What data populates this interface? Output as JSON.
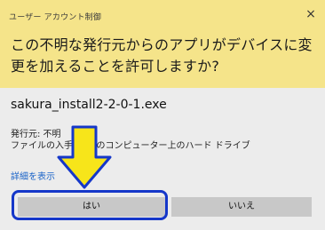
{
  "dialog": {
    "title": "ユーザー アカウント制御",
    "close_glyph": "×",
    "question": "この不明な発行元からのアプリがデバイスに変更を加えることを許可しますか?",
    "filename": "sakura_install2-2-0-1.exe",
    "publisher": "発行元: 不明",
    "origin": "ファイルの入手先: このコンピューター上のハード ドライブ",
    "details_link": "詳細を表示",
    "yes_label": "はい",
    "no_label": "いいえ"
  },
  "colors": {
    "header_bg": "#f5e48a",
    "focus_ring": "#1537c9",
    "arrow_fill": "#f7e51a",
    "arrow_stroke": "#1537c9"
  },
  "icons": [
    "close-icon",
    "down-arrow-annotation"
  ]
}
